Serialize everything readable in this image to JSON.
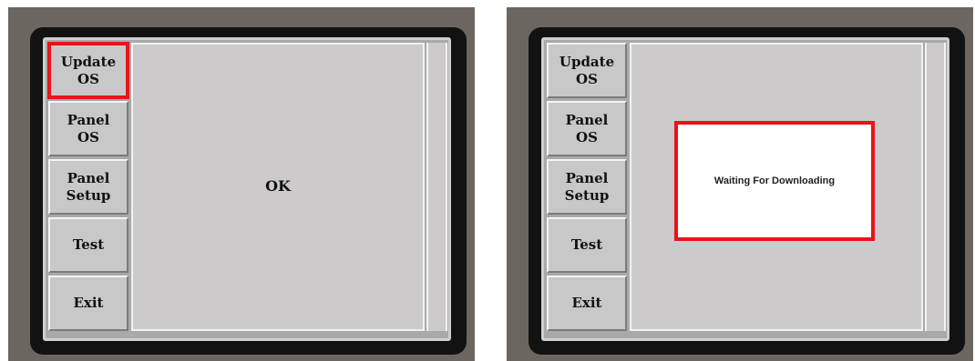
{
  "left_screen": {
    "menu": [
      {
        "label": "Update\nOS"
      },
      {
        "label": "Panel\nOS"
      },
      {
        "label": "Panel\nSetup"
      },
      {
        "label": "Test"
      },
      {
        "label": "Exit"
      }
    ],
    "status_text": "OK"
  },
  "right_screen": {
    "menu": [
      {
        "label": "Update\nOS"
      },
      {
        "label": "Panel\nOS"
      },
      {
        "label": "Panel\nSetup"
      },
      {
        "label": "Test"
      },
      {
        "label": "Exit"
      }
    ],
    "dialog_text": "Waiting For Downloading"
  },
  "colors": {
    "highlight": "#e8141b",
    "device_frame": "#6c6660",
    "bezel": "#121212",
    "button_face": "#c9c8c8",
    "panel_face": "#cccaca"
  }
}
